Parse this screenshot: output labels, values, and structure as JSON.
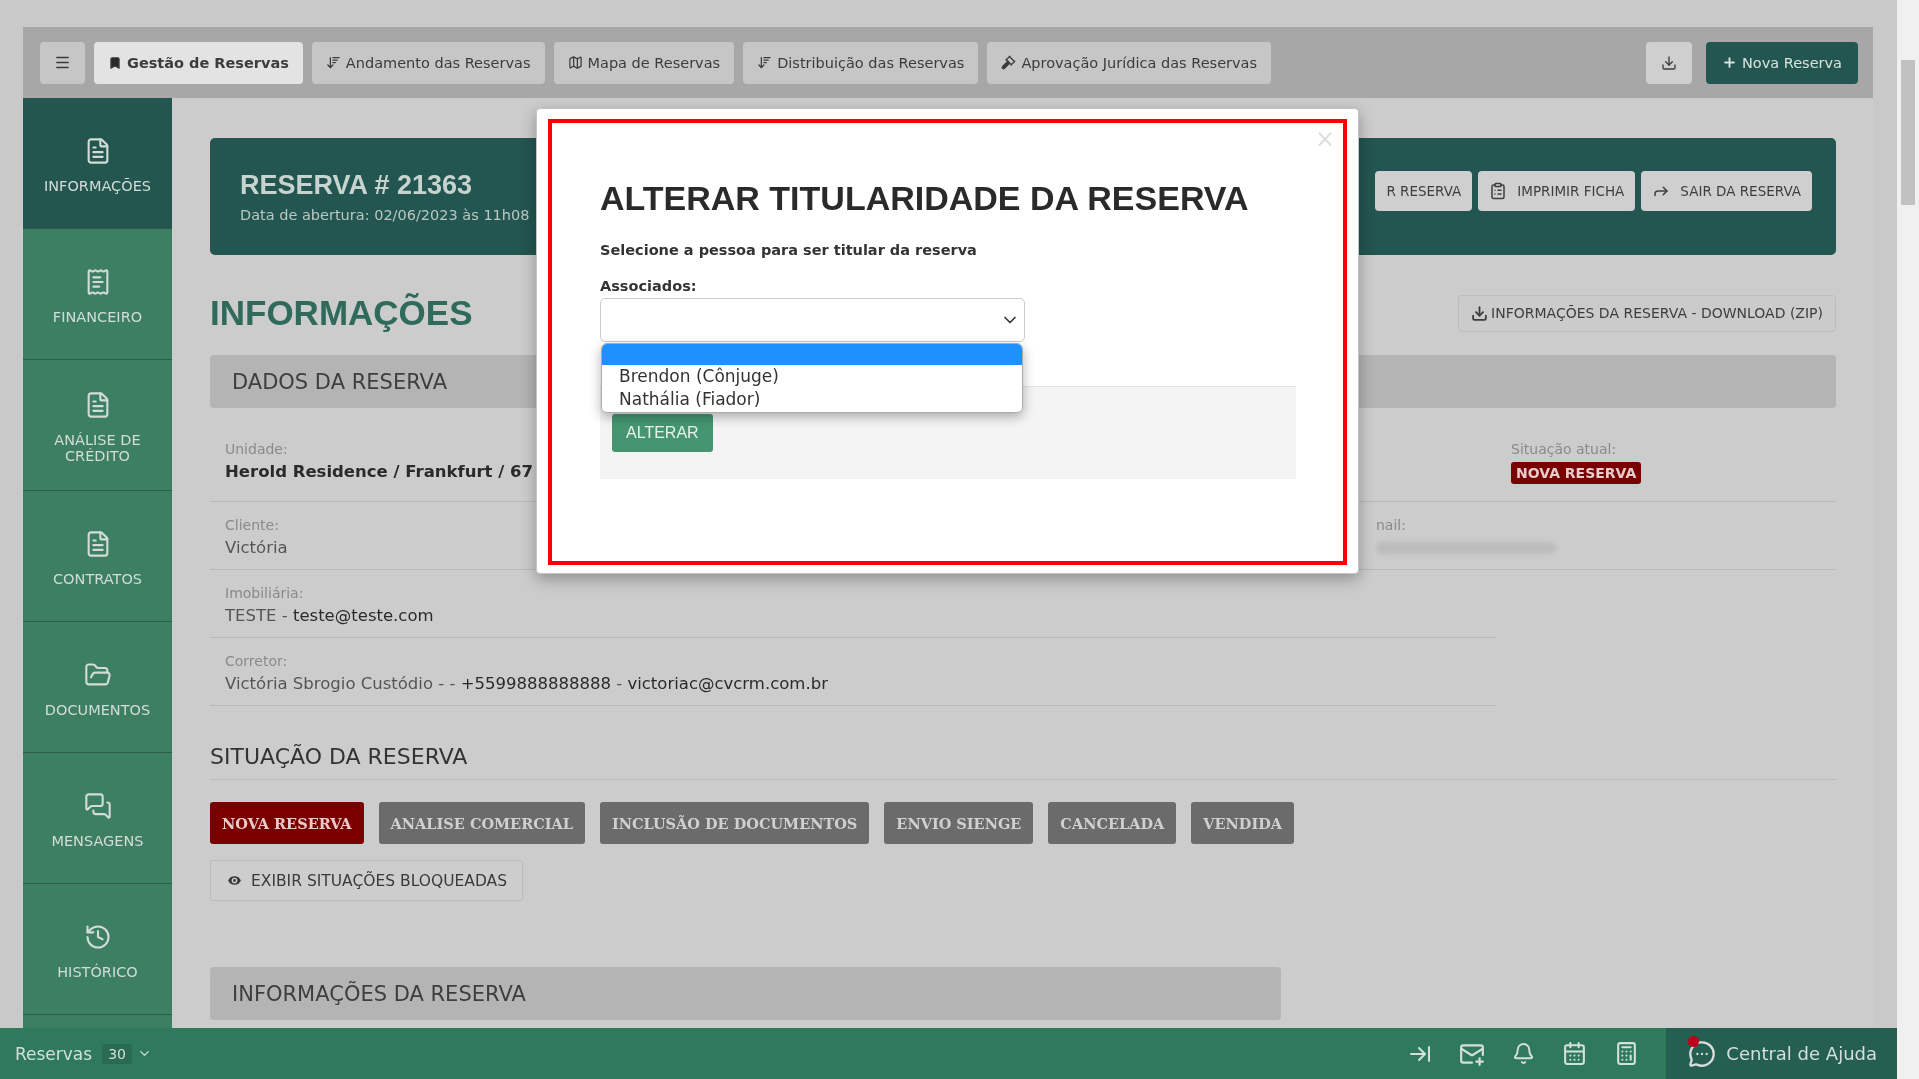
{
  "top_bar": {
    "tabs": [
      {
        "label": "Gestão de Reservas",
        "selected": true
      },
      {
        "label": "Andamento das Reservas",
        "selected": false
      },
      {
        "label": "Mapa de Reservas",
        "selected": false
      },
      {
        "label": "Distribuição das Reservas",
        "selected": false
      },
      {
        "label": "Aprovação Jurídica das Reservas",
        "selected": false
      }
    ],
    "new_button": "Nova Reserva"
  },
  "sidebar": {
    "items": [
      {
        "label": "INFORMAÇÕES",
        "selected": true
      },
      {
        "label": "FINANCEIRO",
        "selected": false
      },
      {
        "label": "ANÁLISE DE CRÉDITO",
        "selected": false
      },
      {
        "label": "CONTRATOS",
        "selected": false
      },
      {
        "label": "DOCUMENTOS",
        "selected": false
      },
      {
        "label": "MENSAGENS",
        "selected": false
      },
      {
        "label": "HISTÓRICO",
        "selected": false
      }
    ]
  },
  "header": {
    "title": "RESERVA # 21363",
    "subtitle": "Data de abertura: 02/06/2023 às 11h08",
    "buttons": [
      "R RESERVA",
      "IMPRIMIR FICHA",
      "SAIR DA RESERVA"
    ]
  },
  "page_title": "INFORMAÇÕES",
  "download_button": "INFORMAÇÕES DA RESERVA - DOWNLOAD (ZIP)",
  "dados": {
    "title": "DADOS DA RESERVA",
    "fields": [
      {
        "label": "Unidade:",
        "parts": [
          {
            "text": "Herold Residence / Frankfurt / 67",
            "strong": true
          }
        ]
      },
      {
        "label": "Cliente:",
        "parts": [
          {
            "text": "Victória",
            "strong": false
          }
        ]
      },
      {
        "label": "Imobiliária:",
        "parts": [
          {
            "text": "TESTE - ",
            "strong": false
          },
          {
            "text": "teste@teste.com",
            "strong": true
          }
        ]
      },
      {
        "label": "Corretor:",
        "parts": [
          {
            "text": "Victória Sbrogio Custódio - - ",
            "strong": false
          },
          {
            "text": "+5599888888888",
            "strong": true
          },
          {
            "text": " - ",
            "strong": false
          },
          {
            "text": "victoriac@cvcrm.com.br",
            "strong": true
          }
        ]
      }
    ],
    "status_label": "Situação atual:",
    "status_badge": "NOVA RESERVA",
    "email_label": "nail:"
  },
  "situacao": {
    "title": "SITUAÇÃO DA RESERVA",
    "statuses": [
      {
        "label": "NOVA RESERVA",
        "selected": true
      },
      {
        "label": "ANALISE COMERCIAL",
        "selected": false
      },
      {
        "label": "INCLUSÃO DE DOCUMENTOS",
        "selected": false
      },
      {
        "label": "ENVIO SIENGE",
        "selected": false
      },
      {
        "label": "CANCELADA",
        "selected": false
      },
      {
        "label": "VENDIDA",
        "selected": false
      }
    ],
    "show_blocked": "EXIBIR SITUAÇÕES BLOQUEADAS"
  },
  "info_section": {
    "title": "INFORMAÇÕES DA RESERVA"
  },
  "modal": {
    "close": "×",
    "title": "ALTERAR TITULARIDADE DA RESERVA",
    "instruction": "Selecione a pessoa para ser titular da reserva",
    "field_label": "Associados:",
    "blank_option_highlighted": true,
    "options": [
      {
        "label": "Brendon (Cônjuge)",
        "selected": false
      },
      {
        "label": "Nathália (Fiador)",
        "selected": false
      }
    ],
    "button": "ALTERAR"
  },
  "bottom_bar": {
    "label": "Reservas",
    "count": "30",
    "help": "Central de Ajuda",
    "help_notification": true
  }
}
